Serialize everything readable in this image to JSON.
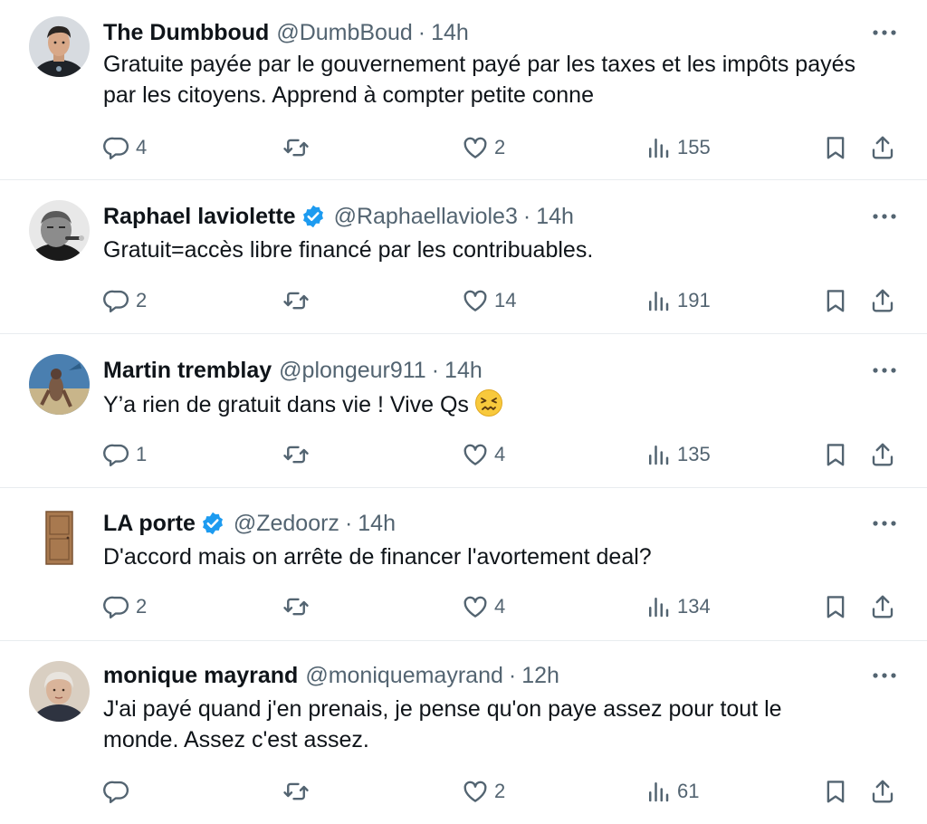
{
  "icons": {
    "reply": "reply-icon",
    "retweet": "retweet-icon",
    "like": "heart-icon",
    "views": "views-icon",
    "bookmark": "bookmark-icon",
    "share": "share-icon",
    "more": "more-icon",
    "verified": "verified-badge-icon"
  },
  "colors": {
    "text": "#0f1419",
    "secondary": "#536471",
    "verified": "#1d9bf0",
    "divider": "#e8ecef"
  },
  "tweets": [
    {
      "name": "The Dumbboud",
      "verified": false,
      "handle": "@DumbBoud",
      "dot": "·",
      "time": "14h",
      "text": "Gratuite payée par le gouvernement payé par les taxes et les impôts payés par les citoyens. Apprend à compter petite conne",
      "replies": "4",
      "retweets": "",
      "likes": "2",
      "views": "155"
    },
    {
      "name": "Raphael laviolette",
      "verified": true,
      "handle": "@Raphaellaviole3",
      "dot": "·",
      "time": "14h",
      "text": "Gratuit=accès libre financé par les contribuables.",
      "replies": "2",
      "retweets": "",
      "likes": "14",
      "views": "191"
    },
    {
      "name": "Martin tremblay",
      "verified": false,
      "handle": "@plongeur911",
      "dot": "·",
      "time": "14h",
      "text": "Y’a rien de gratuit dans vie ! Vive Qs",
      "emoji": "confounded-face-emoji",
      "replies": "1",
      "retweets": "",
      "likes": "4",
      "views": "135"
    },
    {
      "name": "LA porte",
      "verified": true,
      "handle": "@Zedoorz",
      "dot": "·",
      "time": "14h",
      "text": "D'accord mais on arrête de financer l'avortement deal?",
      "replies": "2",
      "retweets": "",
      "likes": "4",
      "views": "134"
    },
    {
      "name": "monique mayrand",
      "verified": false,
      "handle": "@moniquemayrand",
      "dot": "·",
      "time": "12h",
      "text": "J'ai payé quand j'en prenais, je pense qu'on paye assez pour tout le monde. Assez c'est assez.",
      "replies": "",
      "retweets": "",
      "likes": "2",
      "views": "61"
    }
  ]
}
